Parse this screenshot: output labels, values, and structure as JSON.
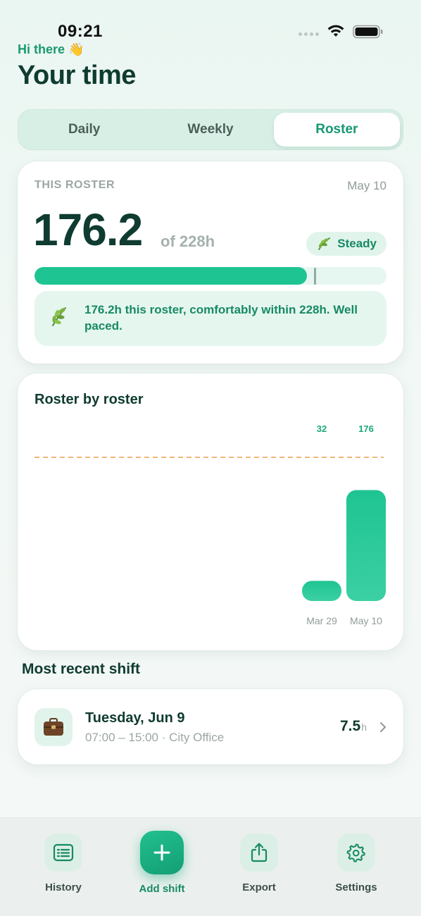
{
  "status_bar": {
    "time": "09:21"
  },
  "header": {
    "greeting": "Hi there 👋",
    "title": "Your time"
  },
  "segmented": {
    "tabs": [
      "Daily",
      "Weekly",
      "Roster"
    ],
    "selected": "Roster"
  },
  "roster_card": {
    "eyebrow": "THIS ROSTER",
    "date": "May 10",
    "hours": "176.2",
    "of_total": "of 228h",
    "badge": "Steady",
    "progress_fraction": 0.773,
    "note": "176.2h this roster, comfortably within 228h. Well paced.",
    "accent_color": "#1fc493"
  },
  "chart": {
    "title": "Roster by roster"
  },
  "chart_data": {
    "type": "bar",
    "categories": [
      "Mar 29",
      "May 10"
    ],
    "values": [
      32,
      176
    ],
    "data_labels": [
      "32",
      "176"
    ],
    "ylim": [
      0,
      228
    ],
    "reference_line": 228,
    "reference_line_style": "dashed-orange",
    "grid": false,
    "bar_color": "#1fc493"
  },
  "recent": {
    "section_title": "Most recent shift",
    "date": "Tuesday, Jun 9",
    "detail": "07:00 – 15:00 · City Office",
    "hours": "7.5",
    "hours_unit": "h"
  },
  "tab_bar": {
    "history": "History",
    "add": "Add shift",
    "export": "Export",
    "settings": "Settings"
  }
}
